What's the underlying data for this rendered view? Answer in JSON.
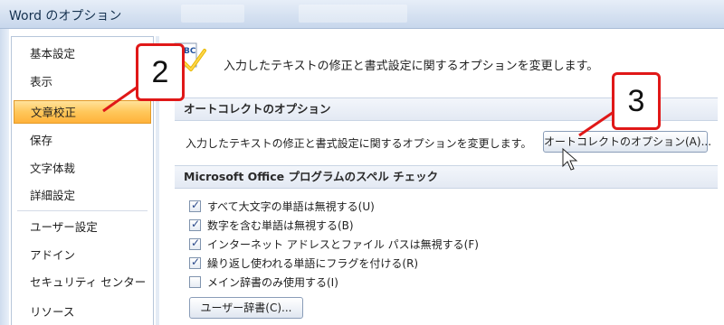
{
  "window": {
    "title": "Word のオプション"
  },
  "sidebar": {
    "items": [
      {
        "label": "基本設定"
      },
      {
        "label": "表示"
      },
      {
        "label": "文章校正",
        "active": true
      },
      {
        "label": "保存"
      },
      {
        "label": "文字体裁"
      },
      {
        "label": "詳細設定"
      },
      {
        "label": "ユーザー設定"
      },
      {
        "label": "アドイン"
      },
      {
        "label": "セキュリティ センター"
      },
      {
        "label": "リソース"
      }
    ]
  },
  "main": {
    "header_icon": "abc-check-icon",
    "header_text": "入力したテキストの修正と書式設定に関するオプションを変更します。",
    "autocorrect": {
      "heading": "オートコレクトのオプション",
      "description": "入力したテキストの修正と書式設定に関するオプションを変更します。",
      "button_label": "オートコレクトのオプション(A)..."
    },
    "spelling": {
      "heading": "Microsoft Office プログラムのスペル チェック",
      "options": [
        {
          "label": "すべて大文字の単語は無視する(U)",
          "checked": true
        },
        {
          "label": "数字を含む単語は無視する(B)",
          "checked": true
        },
        {
          "label": "インターネット アドレスとファイル パスは無視する(F)",
          "checked": true
        },
        {
          "label": "繰り返し使われる単語にフラグを付ける(R)",
          "checked": true
        },
        {
          "label": "メイン辞書のみ使用する(I)",
          "checked": false
        }
      ],
      "dictionary_button_label": "ユーザー辞書(C)..."
    }
  },
  "annotations": {
    "step2": "2",
    "step3": "3",
    "accent_color": "#e01818"
  },
  "colors": {
    "active_item": "#ffc75a",
    "titlebar": "#d5e1f1"
  }
}
